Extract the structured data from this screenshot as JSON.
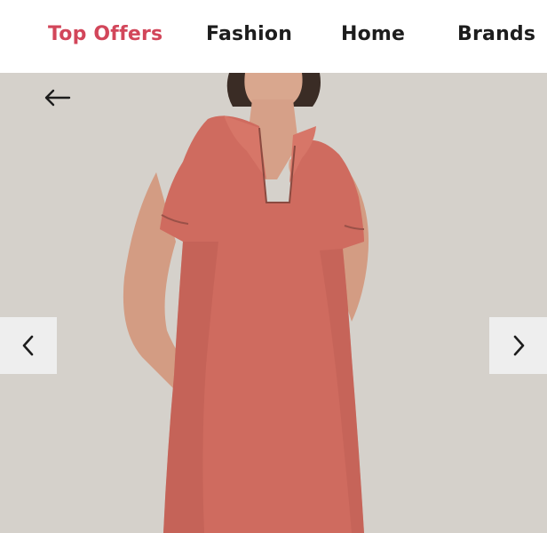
{
  "nav": {
    "items": [
      {
        "label": "Top Offers",
        "active": true
      },
      {
        "label": "Fashion",
        "active": false
      },
      {
        "label": "Home",
        "active": false
      },
      {
        "label": "Brands",
        "active": false
      }
    ]
  },
  "hero": {
    "image_subject": "model wearing coral short-sleeve polo shirt dress",
    "back_icon": "arrow-left-icon",
    "prev_icon": "chevron-left-icon",
    "next_icon": "chevron-right-icon"
  },
  "colors": {
    "accent": "#d2465a",
    "nav_text": "#1d1d1d",
    "hero_bg": "#d6d2cd",
    "dress": "#cf6b5f",
    "button_bg": "#eeeeee"
  }
}
